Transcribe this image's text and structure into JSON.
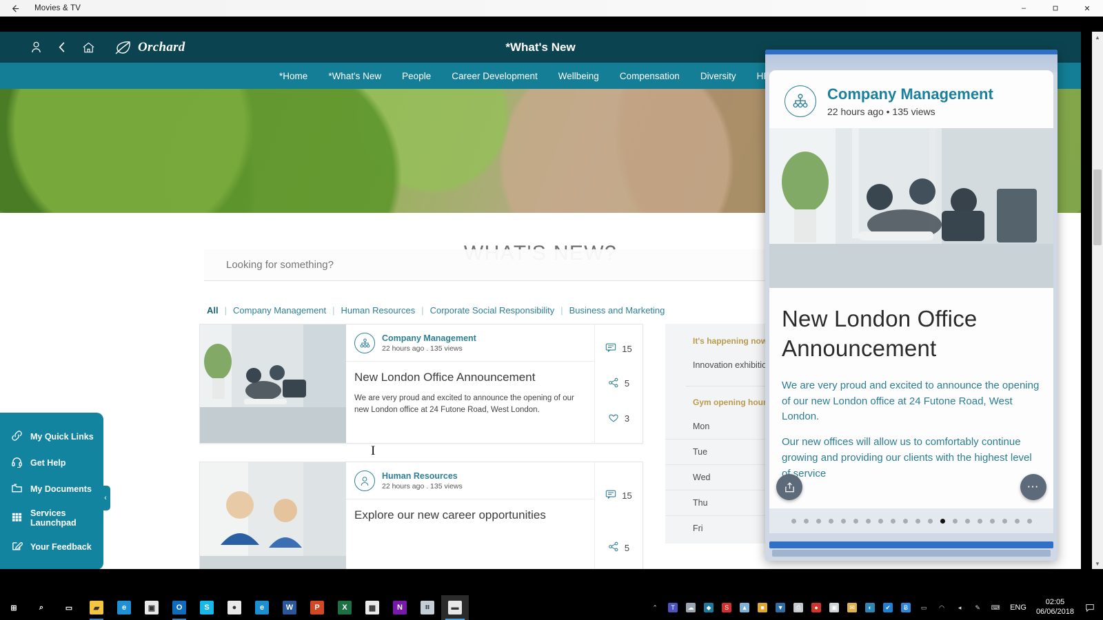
{
  "window": {
    "title": "Movies & TV",
    "back_icon": "back-arrow-icon",
    "minimize": "–",
    "maximize": "❐",
    "close": "✕"
  },
  "site": {
    "brand": "Orchard",
    "page_title": "*What's New",
    "nav": [
      "*Home",
      "*What's New",
      "People",
      "Career Development",
      "Wellbeing",
      "Compensation",
      "Diversity",
      "HR for You"
    ]
  },
  "search": {
    "placeholder": "Looking for something?",
    "value": ""
  },
  "heading": "WHAT'S NEW?",
  "filters": [
    {
      "label": "All",
      "active": true
    },
    {
      "label": "Company Management",
      "active": false
    },
    {
      "label": "Human Resources",
      "active": false
    },
    {
      "label": "Corporate Social Responsibility",
      "active": false
    },
    {
      "label": "Business and Marketing",
      "active": false
    }
  ],
  "cards": [
    {
      "source": "Company Management",
      "meta": "22 hours ago . 135 views",
      "title": "New London Office Announcement",
      "excerpt": "We are very proud and excited to announce the opening of our new London office at 24 Futone Road, West London.",
      "comments": "15",
      "shares": "5",
      "likes": "3"
    },
    {
      "source": "Human Resources",
      "meta": "22 hours ago . 135 views",
      "title": "Explore our new career opportunities",
      "excerpt": "",
      "comments": "15",
      "shares": "5",
      "likes": ""
    }
  ],
  "widgets": {
    "happening": {
      "title": "It's happening now",
      "rows": [
        {
          "label": "Innovation exhibition",
          "value": ""
        }
      ]
    },
    "gym": {
      "title": "Gym opening hours",
      "rows": [
        {
          "label": "Mon",
          "value": ""
        },
        {
          "label": "Tue",
          "value": ""
        },
        {
          "label": "Wed",
          "value": ""
        },
        {
          "label": "Thu",
          "value": ""
        },
        {
          "label": "Fri",
          "value": ""
        }
      ]
    }
  },
  "flyout": {
    "items": [
      {
        "label": "My Quick Links",
        "icon": "link-icon"
      },
      {
        "label": "Get Help",
        "icon": "headset-icon"
      },
      {
        "label": "My Documents",
        "icon": "folder-icon"
      },
      {
        "label": "Services Launchpad",
        "icon": "grid-icon"
      },
      {
        "label": "Your Feedback",
        "icon": "pencil-icon"
      }
    ],
    "collapse": "‹"
  },
  "overlay": {
    "source": "Company Management",
    "meta": "22 hours ago • 135 views",
    "title": "New London Office Announcement",
    "paragraphs": [
      "We are very proud and excited to announce the opening of our new London office at 24 Futone Road, West London.",
      "Our new offices will allow us to comfortably continue growing and providing our clients with the highest level of service"
    ],
    "share_icon": "share-icon",
    "more_icon": "more-options-icon",
    "dots_total": 20,
    "dots_active_index": 12
  },
  "taskbar": {
    "apps": [
      {
        "name": "start-button",
        "glyph": "⊞",
        "color": "#000000",
        "state": ""
      },
      {
        "name": "search-icon",
        "glyph": "⌕",
        "color": "#000000",
        "state": ""
      },
      {
        "name": "task-view-icon",
        "glyph": "▭",
        "color": "#000000",
        "state": ""
      },
      {
        "name": "file-explorer",
        "glyph": "▰",
        "color": "#f5c542",
        "state": "open"
      },
      {
        "name": "edge-browser",
        "glyph": "e",
        "color": "#1f8fd6",
        "state": ""
      },
      {
        "name": "microsoft-store",
        "glyph": "▣",
        "color": "#e8e8e8",
        "state": ""
      },
      {
        "name": "outlook",
        "glyph": "O",
        "color": "#0f6cbd",
        "state": "open"
      },
      {
        "name": "skype",
        "glyph": "S",
        "color": "#18b7ea",
        "state": ""
      },
      {
        "name": "chrome",
        "glyph": "●",
        "color": "#e8e8e8",
        "state": ""
      },
      {
        "name": "internet-explorer",
        "glyph": "e",
        "color": "#1b8fd0",
        "state": ""
      },
      {
        "name": "word",
        "glyph": "W",
        "color": "#2b579a",
        "state": ""
      },
      {
        "name": "powerpoint",
        "glyph": "P",
        "color": "#d24726",
        "state": ""
      },
      {
        "name": "excel",
        "glyph": "X",
        "color": "#1d7044",
        "state": ""
      },
      {
        "name": "calculator",
        "glyph": "▦",
        "color": "#e9e9e9",
        "state": ""
      },
      {
        "name": "onenote",
        "glyph": "N",
        "color": "#7719aa",
        "state": ""
      },
      {
        "name": "remote-desktop",
        "glyph": "⌗",
        "color": "#c3cdd6",
        "state": ""
      },
      {
        "name": "movies-and-tv",
        "glyph": "▬",
        "color": "#e8e8e8",
        "state": "active"
      }
    ],
    "tray": [
      {
        "name": "tray-chevron-up",
        "glyph": "⌃",
        "color": "#ffffff"
      },
      {
        "name": "tray-teams",
        "glyph": "T",
        "color": "#4b53bc"
      },
      {
        "name": "tray-onedrive",
        "glyph": "☁",
        "color": "#9aa6b2"
      },
      {
        "name": "tray-dropbox",
        "glyph": "◆",
        "color": "#1b7a9e"
      },
      {
        "name": "tray-snagit",
        "glyph": "S",
        "color": "#d32f2f"
      },
      {
        "name": "tray-backup",
        "glyph": "▲",
        "color": "#7fb2d9"
      },
      {
        "name": "tray-notes",
        "glyph": "■",
        "color": "#e0a82e"
      },
      {
        "name": "tray-shield",
        "glyph": "▼",
        "color": "#2f6ea5"
      },
      {
        "name": "tray-printer",
        "glyph": "⎙",
        "color": "#c4c9cf"
      },
      {
        "name": "tray-antivirus",
        "glyph": "●",
        "color": "#d0342c"
      },
      {
        "name": "tray-device",
        "glyph": "▣",
        "color": "#cfd4d9"
      },
      {
        "name": "tray-mail",
        "glyph": "✉",
        "color": "#e0b24c"
      },
      {
        "name": "tray-browser",
        "glyph": "◐",
        "color": "#2f86b5"
      },
      {
        "name": "tray-sync",
        "glyph": "✔",
        "color": "#1f7fd0"
      },
      {
        "name": "tray-bluetooth",
        "glyph": "Ƀ",
        "color": "#2f86d8"
      },
      {
        "name": "tray-battery",
        "glyph": "▭",
        "color": "#dcdcdc"
      },
      {
        "name": "tray-wifi",
        "glyph": "◠",
        "color": "#dcdcdc"
      },
      {
        "name": "tray-volume",
        "glyph": "◂",
        "color": "#dcdcdc"
      },
      {
        "name": "tray-pen",
        "glyph": "✎",
        "color": "#dcdcdc"
      },
      {
        "name": "tray-keyboard",
        "glyph": "⌨",
        "color": "#dcdcdc"
      }
    ],
    "language": "ENG",
    "time": "02:05",
    "date": "06/06/2018",
    "notifications_icon": "notification-icon"
  },
  "colors": {
    "header_dark": "#0b4450",
    "nav_teal": "#137e96",
    "link_teal": "#2d7f95",
    "widget_heading": "#b99a4e",
    "flyout": "#1384a0",
    "overlay_blue": "#2f6fc6",
    "taskbar_active": "#4aa3df"
  }
}
